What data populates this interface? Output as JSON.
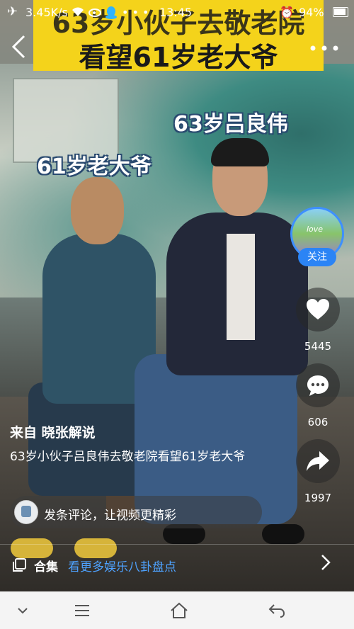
{
  "status_bar": {
    "speed": "3.45K/s",
    "time": "13:45",
    "battery": "94%",
    "battery_level": 0.94,
    "icons": [
      "airplane-icon",
      "wifi-icon",
      "weibo-icon",
      "qq-icon",
      "more-dots-icon",
      "alarm-icon",
      "battery-icon"
    ]
  },
  "video": {
    "banner_line1": "63岁小伙子去敬老院",
    "banner_line2": "看望61岁老大爷",
    "caption_right": "63岁吕良伟",
    "caption_left": "61岁老大爷"
  },
  "author": {
    "avatar_text": "love",
    "follow_label": "关注"
  },
  "actions": {
    "likes": "5445",
    "comments": "606",
    "shares": "1997"
  },
  "info": {
    "source": "来自 晓张解说",
    "description": "63岁小伙子吕良伟去敬老院看望61岁老大爷"
  },
  "comment_bar": {
    "placeholder": "发条评论，让视频更精彩"
  },
  "collection": {
    "label": "合集",
    "link": "看更多娱乐八卦盘点"
  },
  "colors": {
    "banner": "#f4d31b",
    "accent_blue": "#2b84f5",
    "link_blue": "#4ea2ff"
  }
}
